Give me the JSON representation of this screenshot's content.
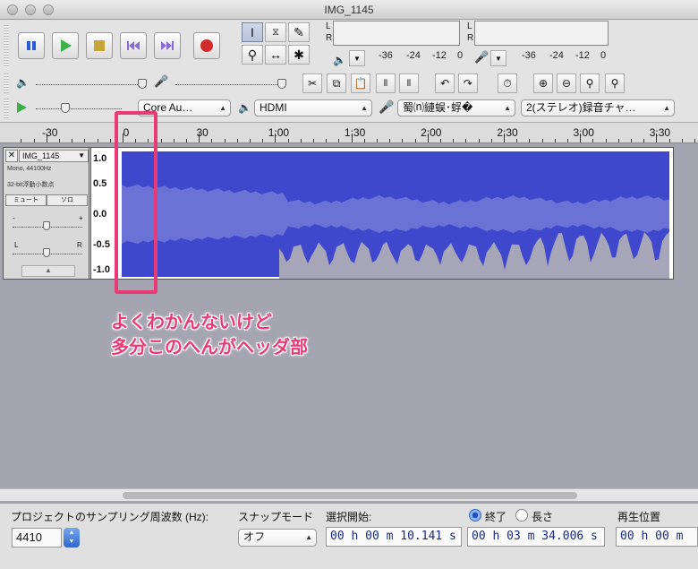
{
  "window": {
    "title": "IMG_1145"
  },
  "meters": {
    "left_label": "L",
    "right_label": "R",
    "scale": [
      "-36",
      "-24",
      "-12",
      "0"
    ]
  },
  "device": {
    "host": "Core Au…",
    "output": "HDMI",
    "input": "蜀⒩縺蜈･蜉�",
    "channels": "2(ステレオ)録音チャ…"
  },
  "ruler": {
    "labels": [
      "-30",
      "0",
      "30",
      "1:00",
      "1:30",
      "2:00",
      "2:30",
      "3:00",
      "3:30"
    ]
  },
  "track": {
    "name": "IMG_1145",
    "info1": "Mono, 44100Hz",
    "info2": "32-bit浮動小数点",
    "mute": "ミュート",
    "solo": "ソロ",
    "gain_minus": "-",
    "gain_plus": "+",
    "pan_left": "L",
    "pan_right": "R",
    "y_axis": [
      "1.0",
      "0.5",
      "0.0",
      "-0.5",
      "-1.0"
    ]
  },
  "annotation": {
    "line1": "よくわかんないけど",
    "line2": "多分このへんがヘッダ部",
    "color": "#e93a75"
  },
  "colors": {
    "wave_dark": "#3f48cc",
    "wave_light": "#6a72d6",
    "accent": "#e93a75"
  },
  "bottom": {
    "rate_label": "プロジェクトのサンプリング周波数 (Hz):",
    "rate_value": "4410",
    "snap_label": "スナップモード",
    "snap_value": "オフ",
    "sel_start_label": "選択開始:",
    "end_label": "終了",
    "length_label": "長さ",
    "playpos_label": "再生位置",
    "sel_start_value": "00 h 00 m 10.141 s",
    "end_value": "00 h 03 m 34.006 s",
    "playpos_value": "00 h 00 m"
  }
}
